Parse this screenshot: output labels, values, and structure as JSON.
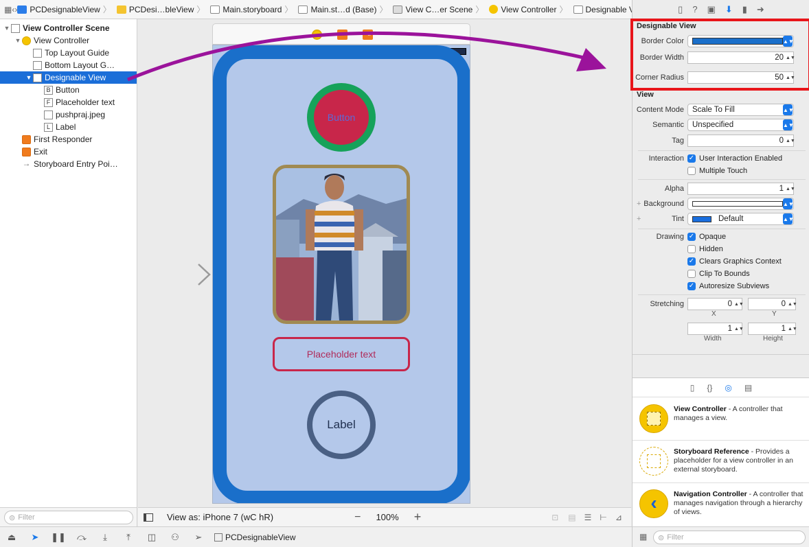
{
  "breadcrumb": [
    {
      "label": "PCDesignableView",
      "icon": "project-icon"
    },
    {
      "label": "PCDesi…bleView",
      "icon": "folder-icon"
    },
    {
      "label": "Main.storyboard",
      "icon": "storyboard-icon"
    },
    {
      "label": "Main.st…d (Base)",
      "icon": "storyboard-icon"
    },
    {
      "label": "View C…er Scene",
      "icon": "scene-icon"
    },
    {
      "label": "View Controller",
      "icon": "view-controller-icon"
    },
    {
      "label": "Designable View",
      "icon": "view-icon"
    }
  ],
  "outline": {
    "items": [
      {
        "label": "View Controller Scene",
        "indent": 0,
        "tri": "▼",
        "icon": "scene",
        "bold": true
      },
      {
        "label": "View Controller",
        "indent": 1,
        "tri": "▼",
        "icon": "y"
      },
      {
        "label": "Top Layout Guide",
        "indent": 2,
        "tri": "",
        "icon": "box"
      },
      {
        "label": "Bottom Layout G…",
        "indent": 2,
        "tri": "",
        "icon": "box"
      },
      {
        "label": "Designable View",
        "indent": 2,
        "tri": "▼",
        "icon": "box",
        "selected": true
      },
      {
        "label": "Button",
        "indent": 3,
        "tri": "",
        "icon": "B"
      },
      {
        "label": "Placeholder text",
        "indent": 3,
        "tri": "",
        "icon": "F"
      },
      {
        "label": "pushpraj.jpeg",
        "indent": 3,
        "tri": "",
        "icon": "img"
      },
      {
        "label": "Label",
        "indent": 3,
        "tri": "",
        "icon": "L"
      },
      {
        "label": "First Responder",
        "indent": 1,
        "tri": "",
        "icon": "o"
      },
      {
        "label": "Exit",
        "indent": 1,
        "tri": "",
        "icon": "o"
      },
      {
        "label": "Storyboard Entry Poi…",
        "indent": 1,
        "tri": "",
        "icon": "arrow"
      }
    ],
    "filter_placeholder": "Filter"
  },
  "canvas": {
    "button_label": "Button",
    "placeholder_label": "Placeholder text",
    "label_text": "Label",
    "view_as": "View as: iPhone 7 (wC hR)",
    "zoom": "100%"
  },
  "inspector": {
    "designable_title": "Designable View",
    "border_color_label": "Border Color",
    "border_width_label": "Border Width",
    "border_width_value": "20",
    "corner_radius_label": "Corner Radius",
    "corner_radius_value": "50",
    "view_title": "View",
    "content_mode_label": "Content Mode",
    "content_mode_value": "Scale To Fill",
    "semantic_label": "Semantic",
    "semantic_value": "Unspecified",
    "tag_label": "Tag",
    "tag_value": "0",
    "interaction_label": "Interaction",
    "user_interaction": "User Interaction Enabled",
    "multiple_touch": "Multiple Touch",
    "alpha_label": "Alpha",
    "alpha_value": "1",
    "background_label": "Background",
    "tint_label": "Tint",
    "tint_value": "Default",
    "drawing_label": "Drawing",
    "opaque": "Opaque",
    "hidden": "Hidden",
    "clears": "Clears Graphics Context",
    "clip": "Clip To Bounds",
    "autoresize": "Autoresize Subviews",
    "stretching_label": "Stretching",
    "stretch_x": "0",
    "stretch_y": "0",
    "stretch_w": "1",
    "stretch_h": "1",
    "x_label": "X",
    "y_label": "Y",
    "width_label": "Width",
    "height_label": "Height"
  },
  "library": {
    "items": [
      {
        "title": "View Controller",
        "desc": " - A controller that manages a view."
      },
      {
        "title": "Storyboard Reference",
        "desc": " - Provides a placeholder for a view controller in an external storyboard."
      },
      {
        "title": "Navigation Controller",
        "desc": " - A controller that manages navigation through a hierarchy of views."
      }
    ],
    "filter_placeholder": "Filter"
  },
  "status": {
    "scheme": "PCDesignableView"
  },
  "colors": {
    "accent": "#1a79ea",
    "border": "#1a6fca",
    "annotation": "#9b139b",
    "highlight": "#e8151a"
  }
}
